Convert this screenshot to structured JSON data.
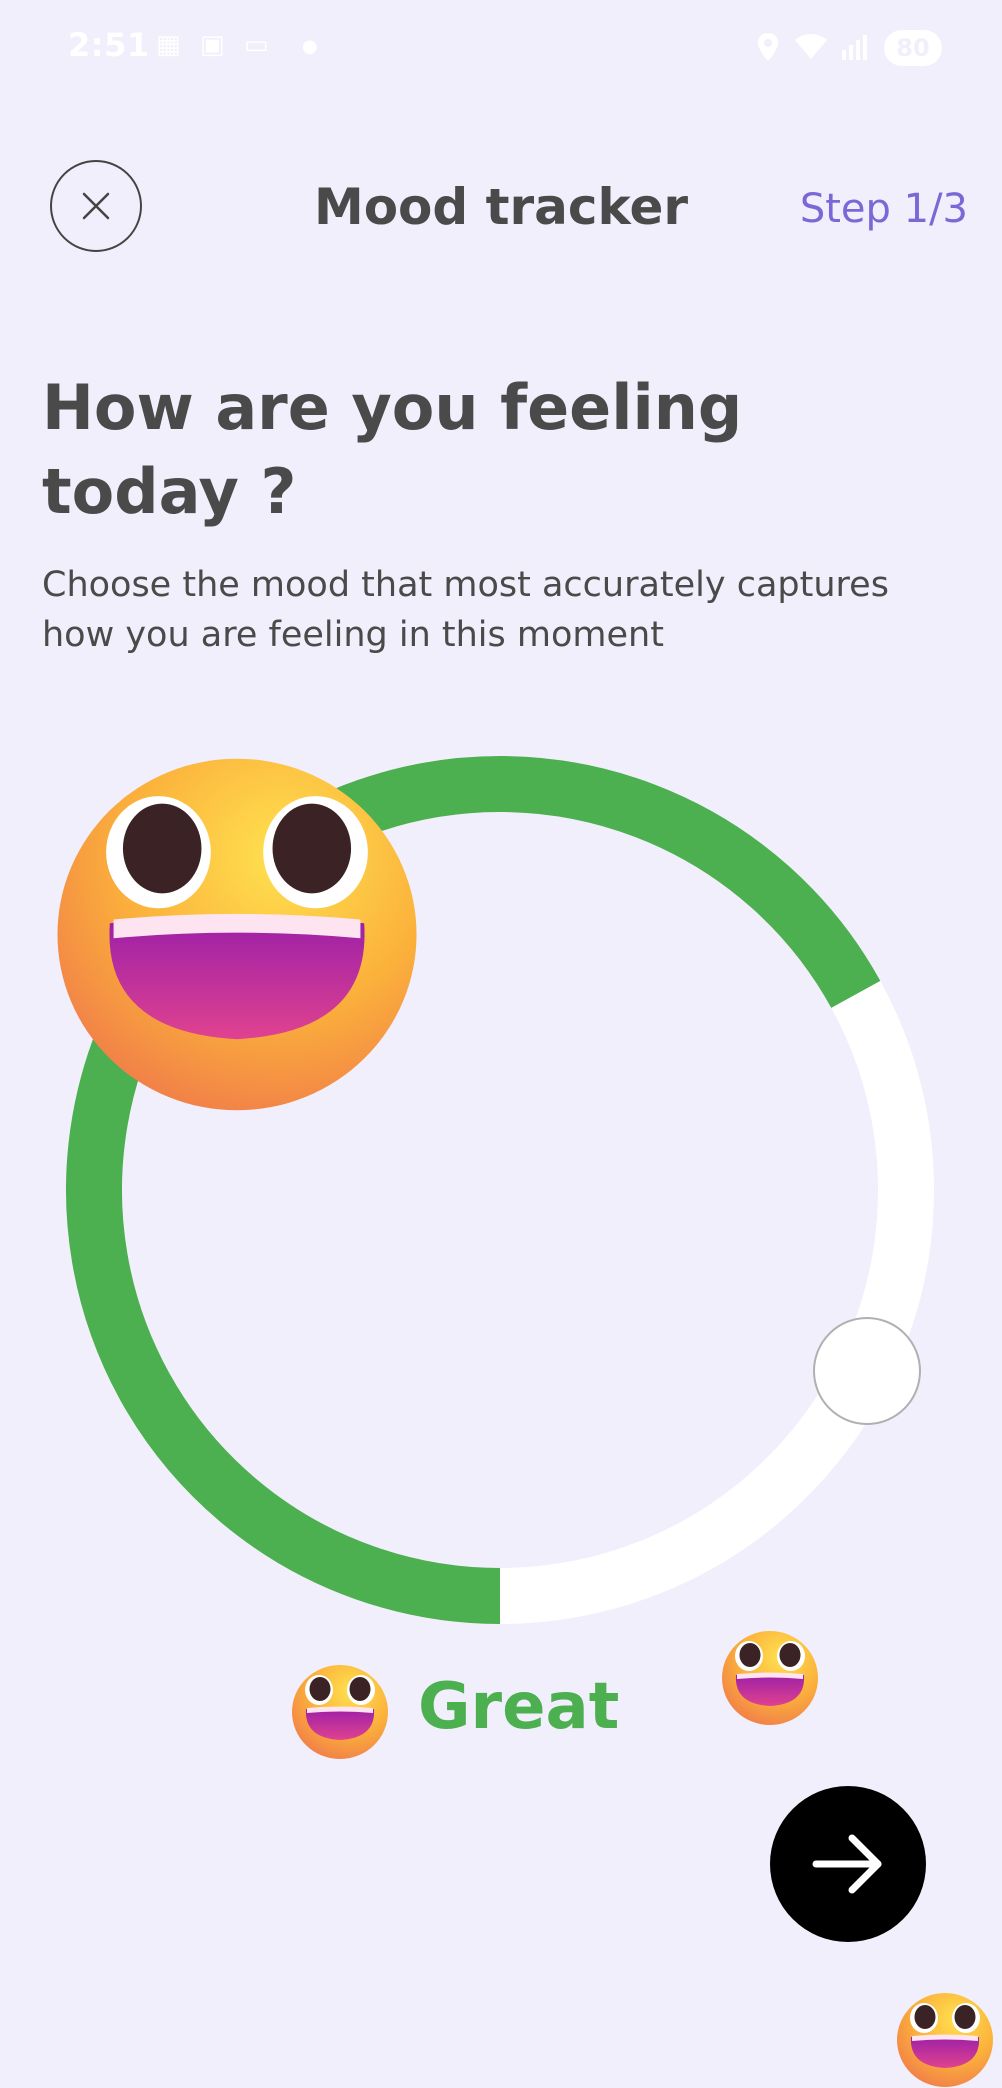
{
  "status_bar": {
    "time": "2:51",
    "battery": "80",
    "icons": [
      "notification-icon",
      "screenshot-icon",
      "cast-icon",
      "dot-icon",
      "location-icon",
      "wifi-icon",
      "signal-icon"
    ]
  },
  "header": {
    "title": "Mood tracker",
    "step": "Step 1/3",
    "close_icon": "close-icon"
  },
  "question": {
    "heading": "How are you feeling today ?",
    "subtitle": "Choose the mood that most accurately captures how you are feeling in this moment"
  },
  "mood": {
    "selected_label": "Great",
    "dial_level": 0.67,
    "colors": {
      "accent": "#4caf50",
      "track": "#ffffff",
      "step": "#7b68d6"
    }
  },
  "next_button": {
    "icon": "arrow-right-icon"
  }
}
